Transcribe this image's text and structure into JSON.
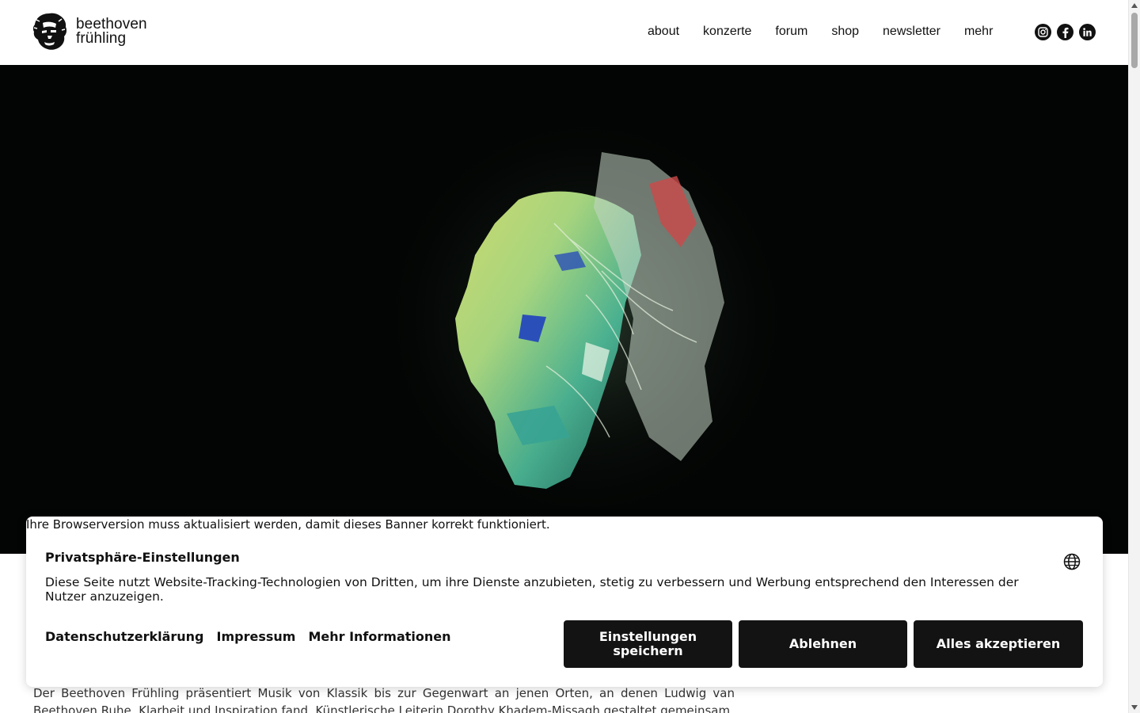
{
  "header": {
    "logo_line1": "beethoven",
    "logo_line2": "frühling",
    "nav": [
      "about",
      "konzerte",
      "forum",
      "shop",
      "newsletter",
      "mehr"
    ],
    "social_icons": [
      "instagram-icon",
      "facebook-icon",
      "linkedin-icon"
    ]
  },
  "intro": {
    "text": "Der Beethoven Frühling präsentiert Musik von Klassik bis zur Gegenwart an jenen Orten, an denen Ludwig van Beethoven Ruhe, Klarheit und Inspiration fand. Künstlerische Leiterin Dorothy Khadem-Missagh gestaltet gemeinsam"
  },
  "cookie_banner": {
    "browser_warning": "Ihre Browserversion muss aktualisiert werden, damit dieses Banner korrekt funktioniert.",
    "title": "Privatsphäre-Einstellungen",
    "description": "Diese Seite nutzt Website-Tracking-Technologien von Dritten, um ihre Dienste anzubieten, stetig zu verbessern und Werbung entsprechend den Interessen der Nutzer anzuzeigen.",
    "links": [
      "Datenschutzerklärung",
      "Impressum",
      "Mehr Informationen"
    ],
    "buttons": {
      "settings": "Einstellungen speichern",
      "decline": "Ablehnen",
      "accept": "Alles akzeptieren"
    }
  },
  "colors": {
    "button_bg": "#131313",
    "hero_bg": "#030504",
    "text": "#111111"
  }
}
